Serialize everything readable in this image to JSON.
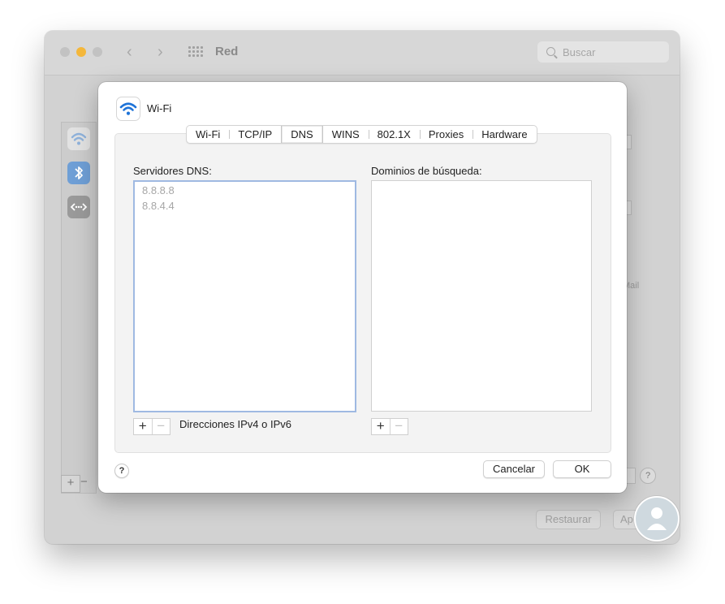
{
  "window": {
    "title": "Red",
    "search_placeholder": "Buscar",
    "traffic_colors": [
      "#c2c2c2",
      "#f4b73b",
      "#c2c2c2"
    ],
    "background_buttons": {
      "restore": "Restaurar",
      "apply": "Ap"
    },
    "background_label": "Mail",
    "background_help": "?",
    "background_plus": "+",
    "background_minus": "−"
  },
  "sheet": {
    "title": "Wi-Fi",
    "tabs": [
      {
        "label": "Wi-Fi",
        "selected": false
      },
      {
        "label": "TCP/IP",
        "selected": false
      },
      {
        "label": "DNS",
        "selected": true
      },
      {
        "label": "WINS",
        "selected": false
      },
      {
        "label": "802.1X",
        "selected": false
      },
      {
        "label": "Proxies",
        "selected": false
      },
      {
        "label": "Hardware",
        "selected": false
      }
    ],
    "dns": {
      "label": "Servidores DNS:",
      "servers": [
        "8.8.8.8",
        "8.8.4.4"
      ],
      "hint": "Direcciones IPv4 o IPv6"
    },
    "search_domains": {
      "label": "Dominios de búsqueda:",
      "items": []
    },
    "add_label": "+",
    "remove_label": "−",
    "help_label": "?",
    "cancel_label": "Cancelar",
    "ok_label": "OK"
  },
  "colors": {
    "accent": "#1e73d8",
    "focus_ring": "#9fb9e2"
  },
  "icons": [
    "wifi-icon",
    "bluetooth-icon",
    "ethernet-icon",
    "search-icon",
    "grid-icon",
    "chevron-left-icon",
    "chevron-right-icon"
  ]
}
